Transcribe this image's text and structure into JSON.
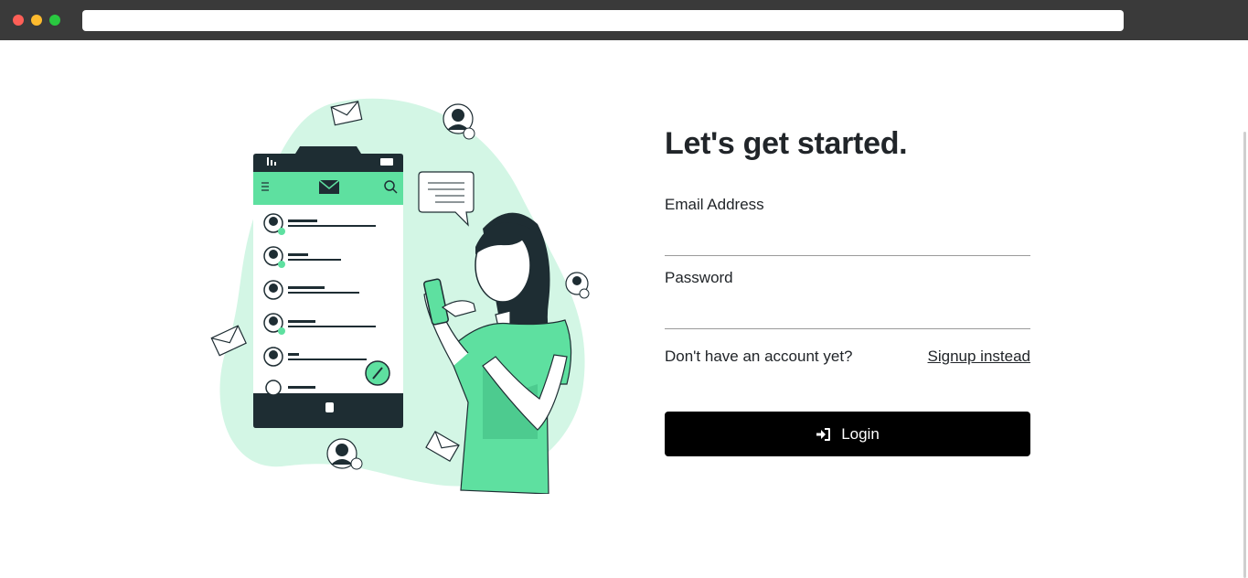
{
  "browser": {
    "url": ""
  },
  "illustration": {
    "icon": "woman-with-phone-illustration"
  },
  "form": {
    "title": "Let's get started.",
    "email": {
      "label": "Email Address",
      "value": "",
      "placeholder": ""
    },
    "password": {
      "label": "Password",
      "value": "",
      "placeholder": ""
    },
    "signup_prompt": "Don't have an account yet?",
    "signup_link": "Signup instead",
    "login_label": "Login",
    "login_icon": "sign-in-icon"
  },
  "colors": {
    "accent": "#5ee0a0",
    "accent_light": "#d3f6e5",
    "dark": "#1e2d33",
    "button": "#000000"
  }
}
